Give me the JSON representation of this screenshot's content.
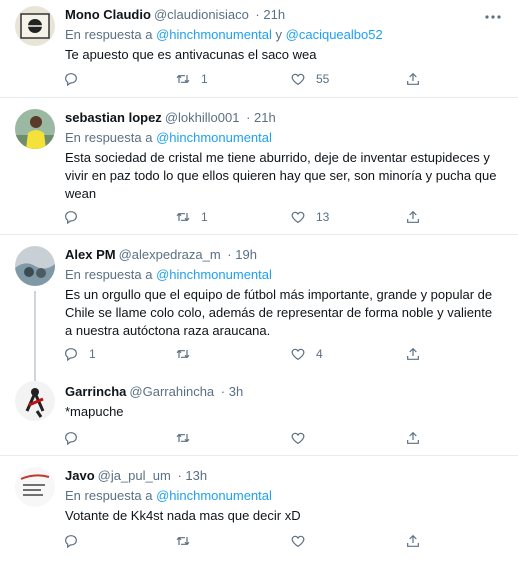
{
  "colors": {
    "accent": "#1da1f2",
    "secondary_text": "#5b7083",
    "divider": "#e6ecf0"
  },
  "tweets": [
    {
      "name": "Mono Claudio",
      "handle": "@claudionisiaco",
      "time": "· 21h",
      "replying_prefix": "En respuesta a",
      "mention1": "@hinchmonumental",
      "conj": "y",
      "mention2": "@caciquealbo52",
      "text": "Te apuesto que es antivacunas el saco wea",
      "replies": "",
      "retweets": "1",
      "likes": "55"
    },
    {
      "name": "sebastian lopez",
      "handle": "@lokhillo001",
      "time": "· 21h",
      "replying_prefix": "En respuesta a",
      "mention1": "@hinchmonumental",
      "text": "Esta sociedad de cristal me tiene aburrido, deje de inventar estupideces y vivir en paz todo lo que ellos quieren hay que ser, son minoría y pucha que wean",
      "replies": "",
      "retweets": "1",
      "likes": "13"
    },
    {
      "name": "Alex PM",
      "handle": "@alexpedraza_m",
      "time": "· 19h",
      "replying_prefix": "En respuesta a",
      "mention1": "@hinchmonumental",
      "text": "Es un orgullo que el equipo de fútbol más importante, grande y popular de Chile se llame colo colo, además de representar de forma noble y valiente a nuestra autóctona raza araucana.",
      "replies": "1",
      "retweets": "",
      "likes": "4"
    },
    {
      "name": "Garrincha",
      "handle": "@Garrahincha",
      "time": "· 3h",
      "text": "*mapuche",
      "replies": "",
      "retweets": "",
      "likes": ""
    },
    {
      "name": "Javo",
      "handle": "@ja_pul_um",
      "time": "· 13h",
      "replying_prefix": "En respuesta a",
      "mention1": "@hinchmonumental",
      "text": "Votante de Kk4st nada mas que decir xD",
      "replies": "",
      "retweets": "",
      "likes": ""
    }
  ],
  "icons": {
    "reply": "reply-icon",
    "retweet": "retweet-icon",
    "like": "heart-icon",
    "share": "share-icon",
    "more": "more-icon"
  }
}
